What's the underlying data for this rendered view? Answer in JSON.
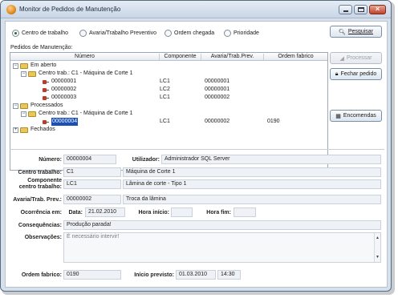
{
  "window": {
    "title": "Monitor de Pedidos de Manutenção"
  },
  "filters": {
    "options": [
      {
        "label": "Centro de trabalho",
        "selected": true
      },
      {
        "label": "Avaria/Trabalho Preventivo",
        "selected": false
      },
      {
        "label": "Ordem chegada",
        "selected": false
      },
      {
        "label": "Prioridade",
        "selected": false
      }
    ],
    "search_label": "Pesquisar"
  },
  "tree": {
    "section_label": "Pedidos de Manutenção:",
    "columns": [
      "Número",
      "Componente",
      "Avaria/Trab.Prev.",
      "Ordem fabrico"
    ],
    "groups": {
      "open": "Em aberto",
      "open_center": "Centro trab.: C1 - Máquina de Corte 1",
      "processed": "Processados",
      "processed_center": "Centro trab.: C1 - Máquina de Corte 1",
      "closed": "Fechados"
    },
    "open_rows": [
      {
        "number": "00000001",
        "component": "LC1",
        "fault": "00000001",
        "order": ""
      },
      {
        "number": "00000002",
        "component": "LC2",
        "fault": "00000001",
        "order": ""
      },
      {
        "number": "00000003",
        "component": "LC1",
        "fault": "00000002",
        "order": ""
      }
    ],
    "processed_rows": [
      {
        "number": "00000004",
        "component": "LC1",
        "fault": "00000002",
        "order": "0190"
      }
    ]
  },
  "actions": {
    "process": "Processar",
    "close_order": "Fechar pedido",
    "orders": "Encomendas"
  },
  "details": {
    "number_label": "Número:",
    "number": "00000004",
    "user_label": "Utilizador:",
    "user": "Administrador SQL Server",
    "center_label": "Centro trabalho:",
    "center_code": "C1",
    "center_name": "Máquina de Corte 1",
    "component_label_1": "Componente",
    "component_label_2": "centro trabalho:",
    "component_code": "LC1",
    "component_name": "Lâmina de corte - Tipo 1",
    "fault_label": "Avaria/Trab. Prev.:",
    "fault_code": "00000002",
    "fault_name": "Troca da lâmina",
    "occurrence_label": "Ocorrência em:",
    "date_label": "Data:",
    "date": "21.02.2010",
    "start_time_label": "Hora início:",
    "start_time": "",
    "end_time_label": "Hora fim:",
    "end_time": "",
    "consequences_label": "Consequências:",
    "consequences": "Produção parada!",
    "observations_label": "Observações:",
    "observations": "É necessário intervir!",
    "production_order_label": "Ordem fabrico:",
    "production_order": "0190",
    "planned_start_label": "Início previsto:",
    "planned_start_date": "01.03.2010",
    "planned_start_time": "14:30"
  }
}
